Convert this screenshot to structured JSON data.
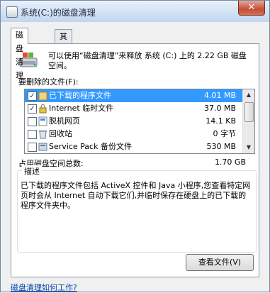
{
  "window": {
    "title": "系统(C:)的磁盘清理",
    "close_label": "✕"
  },
  "tabs": [
    {
      "label": "磁盘清理"
    },
    {
      "label": "其他选项"
    }
  ],
  "header": {
    "text": "可以使用“磁盘清理”来释放 系统 (C:) 上的 2.22 GB 磁盘空间。",
    "icon": "disk-cleanup-icon"
  },
  "list": {
    "label": "要删除的文件(F):",
    "items": [
      {
        "name": "已下载的程序文件",
        "size": "4.01 MB",
        "checked": true,
        "selected": true,
        "icon": "folder-icon"
      },
      {
        "name": "Internet 临时文件",
        "size": "37.0 MB",
        "checked": true,
        "selected": false,
        "icon": "lock-icon"
      },
      {
        "name": "脱机网页",
        "size": "14.1 KB",
        "checked": false,
        "selected": false,
        "icon": "offline-page-icon"
      },
      {
        "name": "回收站",
        "size": "0 字节",
        "checked": false,
        "selected": false,
        "icon": "recycle-bin-icon"
      },
      {
        "name": "Service Pack 备份文件",
        "size": "530 MB",
        "checked": false,
        "selected": false,
        "icon": "service-pack-icon"
      }
    ]
  },
  "total": {
    "label": "占用磁盘空间总数:",
    "value": "1.70 GB"
  },
  "description": {
    "title": "描述",
    "text": "已下载的程序文件包括 ActiveX 控件和 Java 小程序,您查看特定网页时会从 Internet 自动下载它们,并临时保存在硬盘上的已下载的程序文件夹中。"
  },
  "buttons": {
    "view_files": "查看文件(V)"
  },
  "help_link": "磁盘清理如何工作?"
}
